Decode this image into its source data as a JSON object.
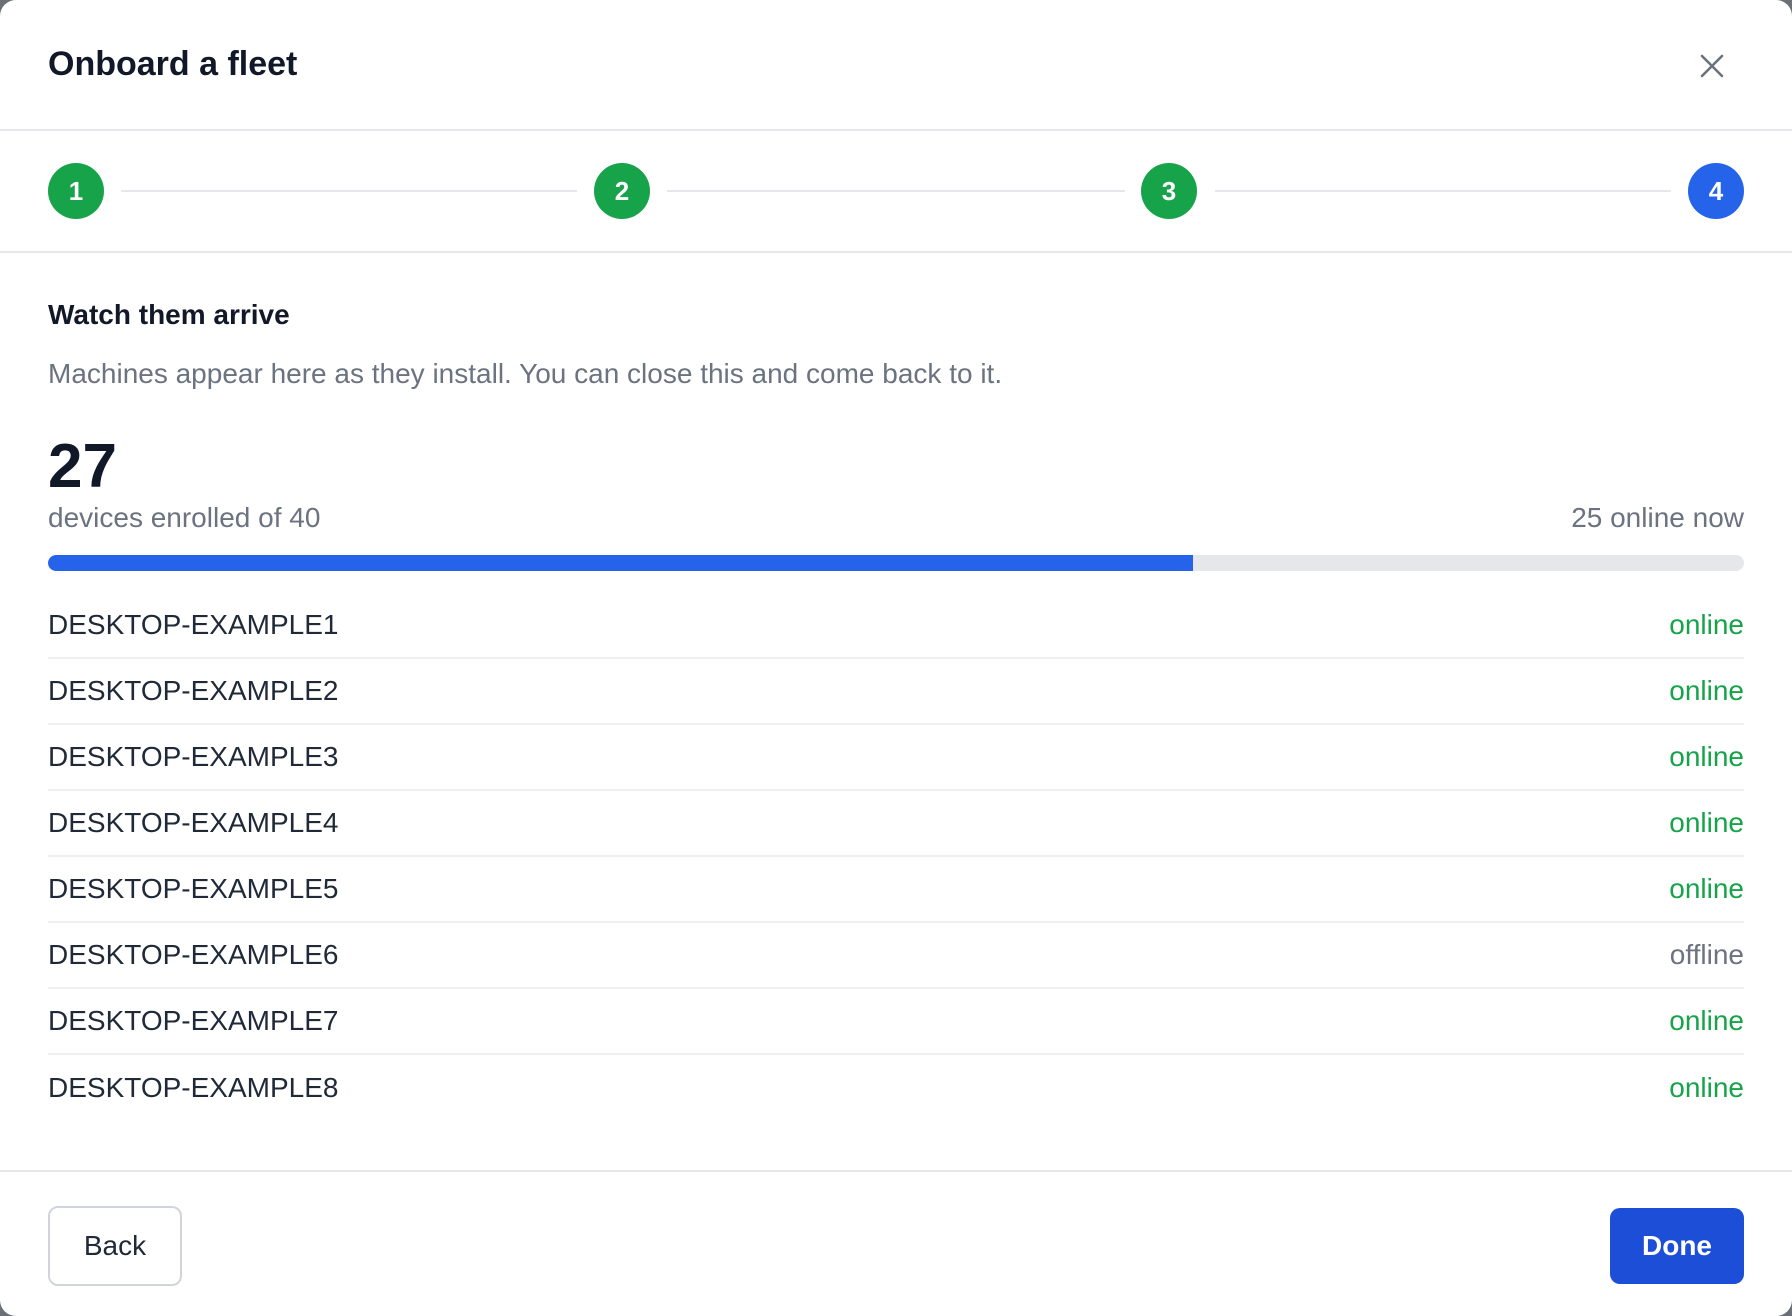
{
  "dialog": {
    "title": "Onboard a fleet",
    "close_icon": "close-icon"
  },
  "stepper": {
    "steps": [
      {
        "label": "1",
        "state": "complete",
        "color": "#16a34a"
      },
      {
        "label": "2",
        "state": "complete",
        "color": "#16a34a"
      },
      {
        "label": "3",
        "state": "complete",
        "color": "#16a34a"
      },
      {
        "label": "4",
        "state": "current",
        "color": "#2563eb"
      }
    ]
  },
  "body": {
    "title": "Watch them arrive",
    "description": "Machines appear here as they install. You can close this and come back to it.",
    "enrolled_count": "27",
    "enrolled_text": "devices enrolled of 40",
    "online_now": "25 online now",
    "progress": {
      "enrolled": 27,
      "total": 40,
      "fraction": 0.675,
      "color": "#2563eb"
    },
    "devices": [
      {
        "name": "DESKTOP-EXAMPLE1",
        "status": "online"
      },
      {
        "name": "DESKTOP-EXAMPLE2",
        "status": "online"
      },
      {
        "name": "DESKTOP-EXAMPLE3",
        "status": "online"
      },
      {
        "name": "DESKTOP-EXAMPLE4",
        "status": "online"
      },
      {
        "name": "DESKTOP-EXAMPLE5",
        "status": "online"
      },
      {
        "name": "DESKTOP-EXAMPLE6",
        "status": "offline"
      },
      {
        "name": "DESKTOP-EXAMPLE7",
        "status": "online"
      },
      {
        "name": "DESKTOP-EXAMPLE8",
        "status": "online"
      }
    ]
  },
  "footer": {
    "back_label": "Back",
    "done_label": "Done"
  },
  "colors": {
    "online": "#16a34a",
    "offline": "#6b7280",
    "primary": "#1d4ed8"
  }
}
